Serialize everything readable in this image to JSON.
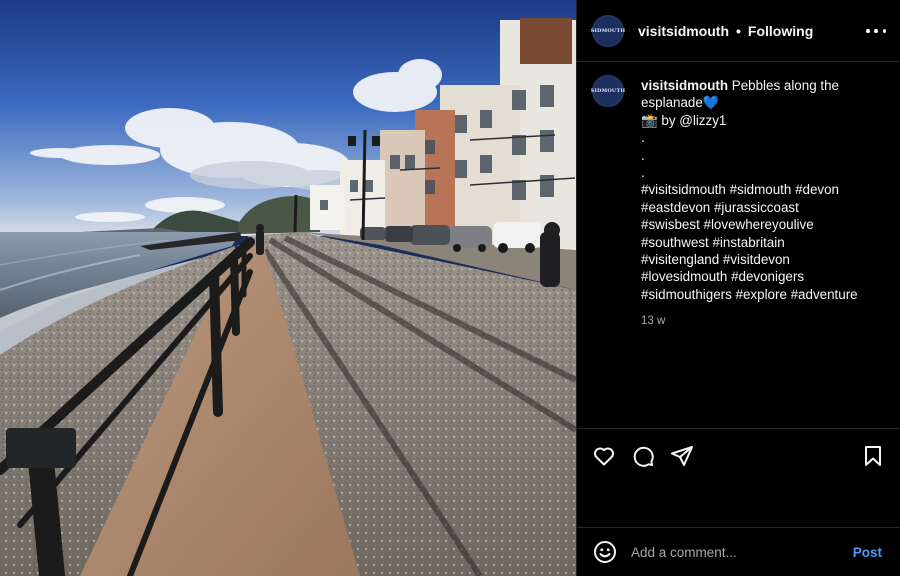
{
  "post": {
    "photo_alt": "Pebbles along the esplanade, Sidmouth seafront promenade",
    "account": {
      "username": "visitsidmouth",
      "avatar_text": "SIDMOUTH",
      "separator": "•",
      "follow_status": "Following"
    },
    "caption": {
      "username": "visitsidmouth",
      "line1_text": " Pebbles along the",
      "line2_text": "esplanade💙",
      "credit": "📸 by @lizzy1",
      "dots": [
        ".",
        ".",
        "."
      ],
      "hashtags": [
        "#visitsidmouth #sidmouth #devon",
        "#eastdevon #jurassiccoast",
        "#swisbest #lovewhereyoulive",
        "#southwest #instabritain",
        "#visitengland #visitdevon",
        "#lovesidmouth #devonigers",
        "#sidmouthigers #explore #adventure"
      ],
      "timestamp": "13 w"
    },
    "actions": {
      "like_icon": "heart-icon",
      "comment_icon": "comment-bubble-icon",
      "share_icon": "paper-plane-icon",
      "save_icon": "bookmark-icon"
    },
    "comment": {
      "placeholder": "Add a comment...",
      "post_label": "Post",
      "emoji_icon": "smiley-icon"
    },
    "colors": {
      "background": "#000000",
      "text": "#f5f5f5",
      "secondary_text": "#a8a8a8",
      "link_blue": "#4a9ef5",
      "divider": "#262626"
    }
  }
}
